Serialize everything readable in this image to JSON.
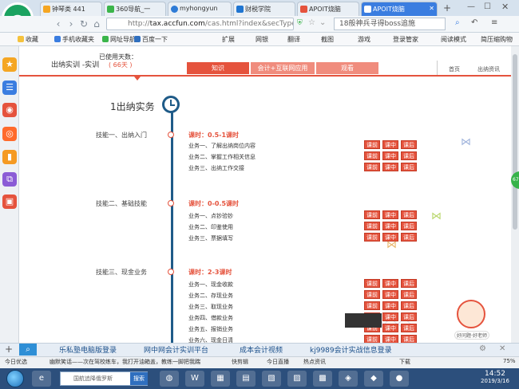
{
  "tabs": [
    {
      "label": "钟琴类 441",
      "active": false,
      "color": "#f5a623"
    },
    {
      "label": "360导航_一",
      "active": false,
      "color": "#3bb54a"
    },
    {
      "label": "myhongyun",
      "active": false,
      "color": "#2e7bd6"
    },
    {
      "label": "财税学院",
      "active": false,
      "color": "#1f75d1"
    },
    {
      "label": "APOIT烧脑",
      "active": false,
      "color": "#e5533d"
    },
    {
      "label": "APOIT烧脑",
      "active": true,
      "color": "#ffffff"
    }
  ],
  "address": {
    "protocol": "http://",
    "host": "tax.accfun.com",
    "path": "/cas.html?index&secType"
  },
  "search": {
    "value": "18般神兵寻得boss追施"
  },
  "favorites": [
    "收藏",
    "手机收藏夹",
    "网址导航",
    "百度一下"
  ],
  "toolbar_right": [
    "扩展",
    "网银",
    "翻译",
    "截图",
    "游戏",
    "登录管家",
    "阅读模式",
    "简压缩购物"
  ],
  "site": {
    "title": "出纳实训 -实训",
    "days_label": "已使用天数：",
    "days_value": "( 66天 )",
    "nav_tabs": [
      "知识",
      "会计+互联网应用",
      "观看"
    ],
    "links": [
      "首页",
      "出纳资讯"
    ]
  },
  "section": {
    "heading": "1出纳实务"
  },
  "skills": [
    {
      "title": "技能一、出纳入门",
      "hours": "课时：0.5-1课时",
      "tasks": [
        "业务一、了解出纳岗位内容",
        "业务二、掌握工作相关信息",
        "业务三、出纳工作交接"
      ]
    },
    {
      "title": "技能二、基础技能",
      "hours": "课时：0-0.5课时",
      "tasks": [
        "业务一、点钞验钞",
        "业务二、印鉴使用",
        "业务三、票据填写"
      ]
    },
    {
      "title": "技能三、现金业务",
      "hours": "课时：2-3课时",
      "tasks": [
        "业务一、现金收款",
        "业务二、存现业务",
        "业务三、取现业务",
        "业务四、借款业务",
        "业务五、报销业务",
        "业务六、现金日清"
      ]
    }
  ],
  "task_buttons": [
    "课前",
    "课中",
    "课后"
  ],
  "avatar_label": "好问题·好老师",
  "ticker": [
    "乐私塾电脑版登录",
    "网中网会计实训平台",
    "成本会计视频",
    "kj9989会计实战信息登录"
  ],
  "statusbar": [
    "今日优选",
    "幽默笑话——次在驾校练车，我打开油箱盖，教练一脚把我踹",
    "快剪辑",
    "今日直播",
    "热点资讯",
    "下载"
  ],
  "taskbar": {
    "search_placeholder": "国航追降俄罗斯",
    "search_button": "搜索",
    "time": "14:52",
    "date": "2019/3/16"
  },
  "colors": {
    "accent": "#e5533d",
    "timeline": "#1f5b88",
    "tab_active": "#3a7de0"
  },
  "icons": [
    "back-icon",
    "forward-icon",
    "refresh-icon",
    "home-icon",
    "star-icon",
    "weibo-icon",
    "gear-icon"
  ]
}
